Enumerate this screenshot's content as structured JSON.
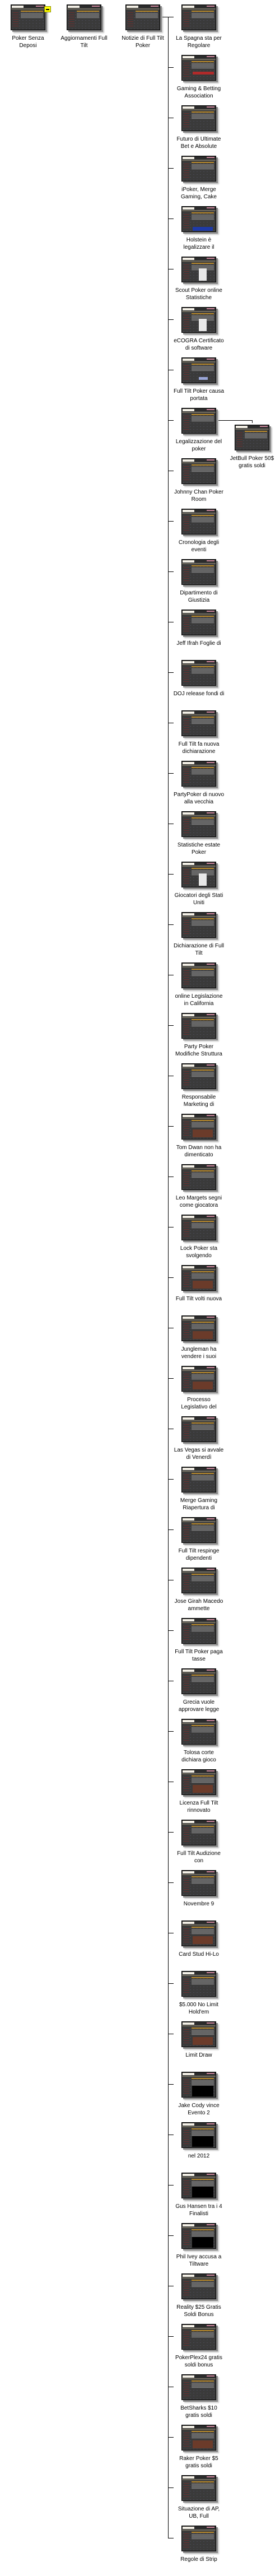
{
  "tree": {
    "top_level": [
      {
        "id": "poker-senza-depositi",
        "lines": [
          "Poker Senza",
          "Deposi"
        ],
        "collapse_control": "collapse-icon"
      },
      {
        "id": "aggiornamenti-full-tilt",
        "lines": [
          "Aggiornamenti Full",
          "Tilt"
        ]
      },
      {
        "id": "notizie-full-tilt-poker",
        "lines": [
          "Notizie di Full Tilt",
          "Poker"
        ]
      }
    ],
    "children_of_notizie": [
      {
        "lines": [
          "La Spagna sta per",
          "Regolare"
        ]
      },
      {
        "lines": [
          "Gaming & Betting",
          "Association"
        ],
        "media": "red-banner"
      },
      {
        "lines": [
          "Futuro di Ultimate",
          "Bet e Absolute"
        ]
      },
      {
        "lines": [
          "iPoker, Merge",
          "Gaming, Cake"
        ]
      },
      {
        "lines": [
          "Holstein è",
          "legalizzare il"
        ],
        "media": "blue-banner"
      },
      {
        "lines": [
          "Scout Poker online",
          "Statistiche"
        ],
        "media": "white-card"
      },
      {
        "lines": [
          "eCOGRA Certificato",
          "di software"
        ],
        "media": "white-card"
      },
      {
        "lines": [
          "Full Tilt Poker causa",
          "portata"
        ],
        "media": "small-logo"
      },
      {
        "lines": [
          "Legalizzazione del",
          "poker"
        ],
        "children": [
          {
            "lines": [
              "JetBull Poker 50$",
              "gratis soldi"
            ]
          }
        ]
      },
      {
        "lines": [
          "Johnny Chan Poker",
          "Room"
        ]
      },
      {
        "lines": [
          "Cronologia degli",
          "eventi"
        ]
      },
      {
        "lines": [
          "Dipartimento di",
          "Giustizia"
        ]
      },
      {
        "lines": [
          "Jeff Ifrah Foglie di"
        ]
      },
      {
        "lines": [
          "DOJ release fondi di"
        ]
      },
      {
        "lines": [
          "Full Tilt fa nuova",
          "dichiarazione"
        ]
      },
      {
        "lines": [
          "PartyPoker di nuovo",
          "alla vecchia"
        ]
      },
      {
        "lines": [
          "Statistiche estate",
          "Poker"
        ]
      },
      {
        "lines": [
          "Giocatori degli Stati",
          "Uniti"
        ],
        "media": "white-card"
      },
      {
        "lines": [
          "Dichiarazione di Full",
          "Tilt"
        ]
      },
      {
        "lines": [
          "online Legislazione",
          "in California"
        ]
      },
      {
        "lines": [
          "Party Poker",
          "Modifiche Struttura"
        ]
      },
      {
        "lines": [
          "Responsabile",
          "Marketing di"
        ]
      },
      {
        "lines": [
          "Tom Dwan non ha",
          "dimenticato"
        ],
        "media": "photo"
      },
      {
        "lines": [
          "Leo Margets segni",
          "come giocatora"
        ]
      },
      {
        "lines": [
          "Lock Poker sta",
          "svolgendo"
        ]
      },
      {
        "lines": [
          "Full Tilt volti nuova"
        ],
        "media": "photo"
      },
      {
        "lines": [
          "Jungleman ha",
          "vendere i suoi"
        ],
        "media": "photo"
      },
      {
        "lines": [
          "Processo",
          "Legislativo del"
        ],
        "media": "photo"
      },
      {
        "lines": [
          "Las Vegas si avvale",
          "di Venerdì"
        ]
      },
      {
        "lines": [
          "Merge Gaming",
          "Riapertura di"
        ]
      },
      {
        "lines": [
          "Full Tilt respinge",
          "dipendenti"
        ]
      },
      {
        "lines": [
          "Jose Girah Macedo",
          "ammette"
        ]
      },
      {
        "lines": [
          "Full Tilt Poker paga",
          "tasse"
        ]
      },
      {
        "lines": [
          "Grecia vuole",
          "approvare legge"
        ]
      },
      {
        "lines": [
          "Tolosa corte",
          "dichiara gioco"
        ]
      },
      {
        "lines": [
          "Licenza Full Tilt",
          "rinnovato"
        ],
        "media": "photo"
      },
      {
        "lines": [
          "Full Tilt Audizione",
          "con"
        ]
      },
      {
        "lines": [
          "Novembre 9"
        ]
      },
      {
        "lines": [
          "Card Stud Hi-Lo"
        ],
        "media": "photo"
      },
      {
        "lines": [
          "$5.000 No Limit",
          "Hold'em"
        ]
      },
      {
        "lines": [
          "Limit Draw"
        ],
        "media": "photo"
      },
      {
        "lines": [
          "Jake Cody vince",
          "Evento 2"
        ],
        "media": "black-video"
      },
      {
        "lines": [
          "nel 2012"
        ],
        "media": "black-video"
      },
      {
        "lines": [
          "Gus Hansen tra i 4",
          "Finalisti"
        ],
        "media": "black-video"
      },
      {
        "lines": [
          "Phil Ivey accusa a",
          "Tiltware"
        ],
        "media": "black-video"
      },
      {
        "lines": [
          "Reality $25 Gratis",
          "Soldi Bonus"
        ]
      },
      {
        "lines": [
          "PokerPlex24 gratis",
          "soldi bonus"
        ]
      },
      {
        "lines": [
          "BetSharks $10",
          "gratis soldi"
        ]
      },
      {
        "lines": [
          "Raker Poker $5",
          "gratis soldi"
        ],
        "media": "photo"
      },
      {
        "lines": [
          "Situazione di AP,",
          "UB, Full"
        ]
      },
      {
        "lines": [
          "Regole di Strip"
        ]
      }
    ]
  },
  "colors": {
    "thumbnail_bg": "#3a3a3a",
    "accent_bar": "#b8892a",
    "collapse_button": "#ffff00",
    "connector": "#000000"
  }
}
